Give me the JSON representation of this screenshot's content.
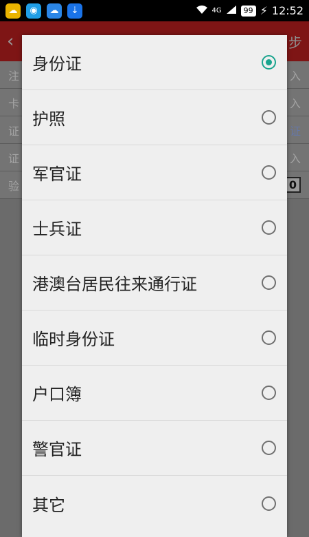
{
  "status_bar": {
    "network": "4G",
    "battery": "99",
    "time": "12:52"
  },
  "underlying_screen": {
    "header": {
      "back_label": "返回",
      "title": "...",
      "next_label": "步"
    },
    "rows": [
      {
        "left": "注",
        "right": "入"
      },
      {
        "left": "卡",
        "right": "入"
      },
      {
        "left": "证",
        "right": "证",
        "right_link": true
      },
      {
        "left": "证",
        "right": "入"
      },
      {
        "left": "验",
        "right": "0",
        "captcha": true
      }
    ]
  },
  "dialog": {
    "options": [
      {
        "label": "身份证",
        "selected": true
      },
      {
        "label": "护照",
        "selected": false
      },
      {
        "label": "军官证",
        "selected": false
      },
      {
        "label": "士兵证",
        "selected": false
      },
      {
        "label": "港澳台居民往来通行证",
        "selected": false
      },
      {
        "label": "临时身份证",
        "selected": false
      },
      {
        "label": "户口簿",
        "selected": false
      },
      {
        "label": "警官证",
        "selected": false
      },
      {
        "label": "其它",
        "selected": false
      }
    ]
  },
  "colors": {
    "selected": "#1aa48e",
    "header": "#b81b1b"
  }
}
